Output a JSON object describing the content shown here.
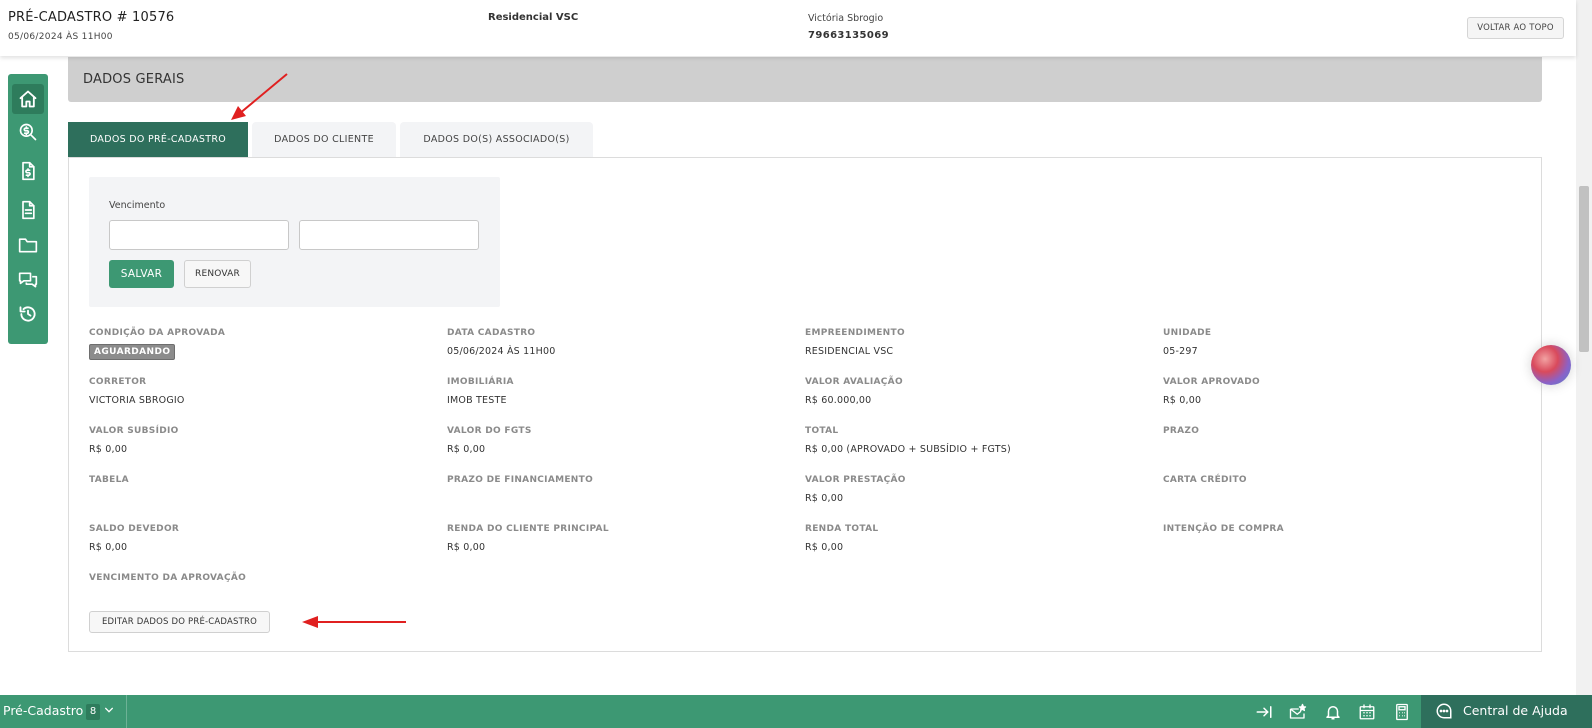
{
  "header": {
    "title": "PRÉ-CADASTRO # 10576",
    "datetime": "05/06/2024 ÀS 11H00",
    "empreendimento": "Residencial VSC",
    "client_name": "Victória Sbrogio",
    "client_doc": "79663135069",
    "back_to_top": "VOLTAR AO TOPO"
  },
  "sidenav": {
    "icons": [
      "home-icon",
      "search-money-icon",
      "invoice-icon",
      "document-icon",
      "folder-icon",
      "chat-icon",
      "history-icon"
    ]
  },
  "section": {
    "title": "DADOS GERAIS"
  },
  "tabs": [
    {
      "label": "DADOS DO PRÉ-CADASTRO",
      "active": true
    },
    {
      "label": "DADOS DO CLIENTE",
      "active": false
    },
    {
      "label": "DADOS DO(S) ASSOCIADO(S)",
      "active": false
    }
  ],
  "vencimento": {
    "label": "Vencimento",
    "input1_value": "",
    "input2_value": "",
    "save": "SALVAR",
    "renew": "RENOVAR"
  },
  "fields": [
    {
      "label": "CONDIÇÃO DA APROVADA",
      "value": "AGUARDANDO"
    },
    {
      "label": "DATA CADASTRO",
      "value": "05/06/2024 ÀS 11H00"
    },
    {
      "label": "EMPREENDIMENTO",
      "value": "RESIDENCIAL VSC"
    },
    {
      "label": "UNIDADE",
      "value": "05-297"
    },
    {
      "label": "CORRETOR",
      "value": "VICTORIA SBROGIO"
    },
    {
      "label": "IMOBILIÁRIA",
      "value": "IMOB TESTE"
    },
    {
      "label": "VALOR AVALIAÇÃO",
      "value": "R$ 60.000,00"
    },
    {
      "label": "VALOR APROVADO",
      "value": "R$ 0,00"
    },
    {
      "label": "VALOR SUBSÍDIO",
      "value": "R$ 0,00"
    },
    {
      "label": "VALOR DO FGTS",
      "value": "R$ 0,00"
    },
    {
      "label": "TOTAL",
      "value": "R$ 0,00 (APROVADO + SUBSÍDIO + FGTS)"
    },
    {
      "label": "PRAZO",
      "value": ""
    },
    {
      "label": "TABELA",
      "value": ""
    },
    {
      "label": "PRAZO DE FINANCIAMENTO",
      "value": ""
    },
    {
      "label": "VALOR PRESTAÇÃO",
      "value": "R$ 0,00"
    },
    {
      "label": "CARTA CRÉDITO",
      "value": ""
    },
    {
      "label": "SALDO DEVEDOR",
      "value": "R$ 0,00"
    },
    {
      "label": "RENDA DO CLIENTE PRINCIPAL",
      "value": "R$ 0,00"
    },
    {
      "label": "RENDA TOTAL",
      "value": "R$ 0,00"
    },
    {
      "label": "INTENÇÃO DE COMPRA",
      "value": ""
    },
    {
      "label": "VENCIMENTO DA APROVAÇÃO",
      "value": ""
    }
  ],
  "edit_button": "EDITAR DADOS DO PRÉ-CADASTRO",
  "bottombar": {
    "title": "Pré-Cadastro",
    "count": "8",
    "help": "Central de Ajuda",
    "icons": [
      "expand-right-icon",
      "mail-star-icon",
      "bell-icon",
      "calendar-icon",
      "calculator-icon"
    ]
  },
  "colors": {
    "primary": "#3d9873",
    "primary_dark": "#2e6f5c",
    "section_bg": "#cfcfcf",
    "annotation_arrow": "#e02020"
  }
}
